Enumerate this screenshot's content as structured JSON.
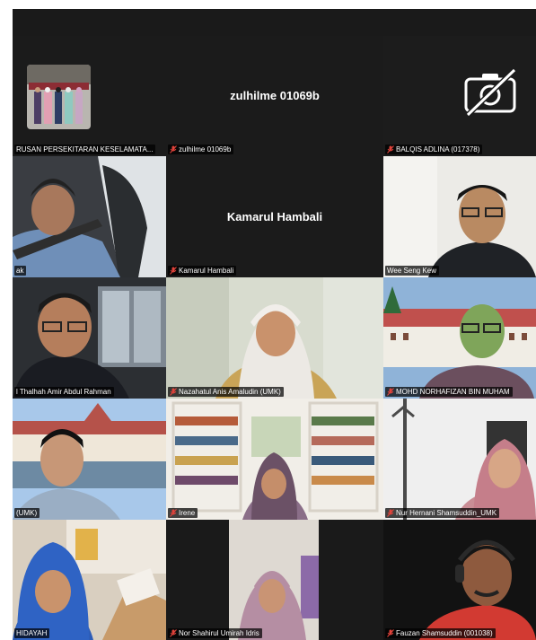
{
  "participants": [
    {
      "name": "RUSAN PERSEKITARAN KESELAMATA...",
      "center": ""
    },
    {
      "name": "zulhilme 01069b",
      "center": "zulhilme 01069b"
    },
    {
      "name": "BALQIS ADLINA (017378)",
      "center": ""
    },
    {
      "name": "ak",
      "center": ""
    },
    {
      "name": "Kamarul Hambali",
      "center": "Kamarul Hambali"
    },
    {
      "name": "Wee Seng Kew",
      "center": ""
    },
    {
      "name": "l Thalhah Amir Abdul Rahman",
      "center": ""
    },
    {
      "name": "Nazahatul Anis Amaludin (UMK)",
      "center": ""
    },
    {
      "name": "MOHD NORHAFIZAN BIN MUHAM",
      "center": ""
    },
    {
      "name": "(UMK)",
      "center": ""
    },
    {
      "name": "Irene",
      "center": ""
    },
    {
      "name": "Nur Hernani Shamsuddin_UMK",
      "center": ""
    },
    {
      "name": "HIDAYAH",
      "center": ""
    },
    {
      "name": "Nor Shahirul Umirah Idris",
      "center": ""
    },
    {
      "name": "Fauzan Shamsuddin (001038)",
      "center": ""
    }
  ],
  "icons": {
    "muted": "mic-muted-icon",
    "camera_off": "camera-off-icon"
  },
  "colors": {
    "background": "#1a1a1a",
    "tile": "#1f1f1f",
    "mute": "#e0433b"
  }
}
